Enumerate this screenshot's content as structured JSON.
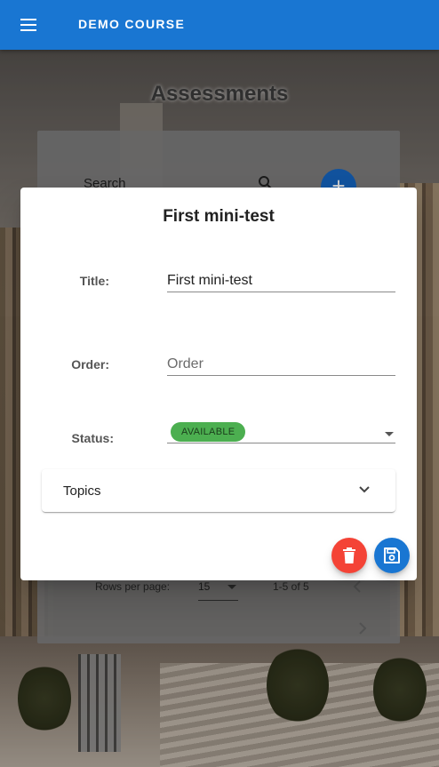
{
  "appbar": {
    "title": "DEMO COURSE",
    "menu_icon": "menu-icon",
    "color": "#1976d2"
  },
  "page": {
    "title": "Assessments",
    "search_label": "Search",
    "search_icon": "search-icon",
    "add_icon": "plus-icon",
    "add_symbol": "+",
    "pagination": {
      "rows_per_page_label": "Rows per page:",
      "rows_per_page_value": "15",
      "range": "1-5 of 5",
      "prev_icon": "chevron-left-icon",
      "next_icon": "chevron-right-icon"
    }
  },
  "dialog": {
    "heading": "First mini-test",
    "title_label": "Title:",
    "title_value": "First mini-test",
    "order_label": "Order:",
    "order_placeholder": "Order",
    "status_label": "Status:",
    "status_value": "AVAILABLE",
    "status_color": "#4caf50",
    "topics_label": "Topics",
    "topics_icon": "chevron-down-icon",
    "delete_icon": "trash-icon",
    "delete_color": "#f44336",
    "save_icon": "floppy-disk-icon",
    "save_color": "#1976d2"
  }
}
